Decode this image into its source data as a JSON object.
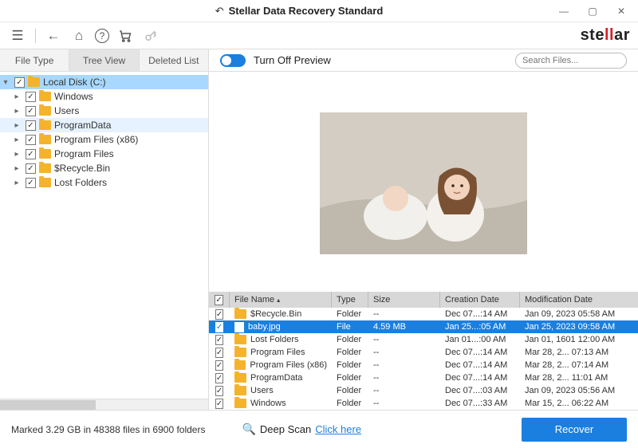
{
  "titlebar": {
    "title": "Stellar Data Recovery Standard"
  },
  "brand": {
    "prefix": "ste",
    "accent": "ll",
    "suffix": "ar"
  },
  "tabs": [
    {
      "label": "File Type",
      "active": false
    },
    {
      "label": "Tree View",
      "active": true
    },
    {
      "label": "Deleted List",
      "active": false
    }
  ],
  "toggle": {
    "label": "Turn Off Preview"
  },
  "search": {
    "placeholder": "Search Files..."
  },
  "tree": {
    "root": {
      "label": "Local Disk (C:)",
      "expanded": true
    },
    "children": [
      {
        "label": "Windows",
        "expanded": false,
        "selected": false
      },
      {
        "label": "Users",
        "expanded": false,
        "selected": false
      },
      {
        "label": "ProgramData",
        "expanded": false,
        "selected": true
      },
      {
        "label": "Program Files (x86)",
        "expanded": false,
        "selected": false
      },
      {
        "label": "Program Files",
        "expanded": false,
        "selected": false
      },
      {
        "label": "$Recycle.Bin",
        "expanded": false,
        "selected": false
      },
      {
        "label": "Lost Folders",
        "expanded": false,
        "selected": false
      }
    ]
  },
  "grid": {
    "headers": {
      "name": "File Name",
      "type": "Type",
      "size": "Size",
      "cdate": "Creation Date",
      "mdate": "Modification Date"
    },
    "rows": [
      {
        "name": "$Recycle.Bin",
        "type": "Folder",
        "size": "--",
        "cdate": "Dec 07...:14 AM",
        "mdate": "Jan 09, 2023 05:58 AM",
        "kind": "folder",
        "selected": false
      },
      {
        "name": "baby.jpg",
        "type": "File",
        "size": "4.59 MB",
        "cdate": "Jan 25...:05 AM",
        "mdate": "Jan 25, 2023 09:58 AM",
        "kind": "file",
        "selected": true
      },
      {
        "name": "Lost Folders",
        "type": "Folder",
        "size": "--",
        "cdate": "Jan 01...:00 AM",
        "mdate": "Jan 01, 1601 12:00 AM",
        "kind": "folder",
        "selected": false
      },
      {
        "name": "Program Files",
        "type": "Folder",
        "size": "--",
        "cdate": "Dec 07...:14 AM",
        "mdate": "Mar 28, 2... 07:13 AM",
        "kind": "folder",
        "selected": false
      },
      {
        "name": "Program Files (x86)",
        "type": "Folder",
        "size": "--",
        "cdate": "Dec 07...:14 AM",
        "mdate": "Mar 28, 2... 07:14 AM",
        "kind": "folder",
        "selected": false
      },
      {
        "name": "ProgramData",
        "type": "Folder",
        "size": "--",
        "cdate": "Dec 07...:14 AM",
        "mdate": "Mar 28, 2... 11:01 AM",
        "kind": "folder",
        "selected": false
      },
      {
        "name": "Users",
        "type": "Folder",
        "size": "--",
        "cdate": "Dec 07...:03 AM",
        "mdate": "Jan 09, 2023 05:56 AM",
        "kind": "folder",
        "selected": false
      },
      {
        "name": "Windows",
        "type": "Folder",
        "size": "--",
        "cdate": "Dec 07...:33 AM",
        "mdate": "Mar 15, 2... 06:22 AM",
        "kind": "folder",
        "selected": false
      }
    ]
  },
  "footer": {
    "status": "Marked 3.29 GB in 48388 files in 6900 folders",
    "deep_label": "Deep Scan",
    "deep_link": "Click here",
    "recover": "Recover"
  }
}
